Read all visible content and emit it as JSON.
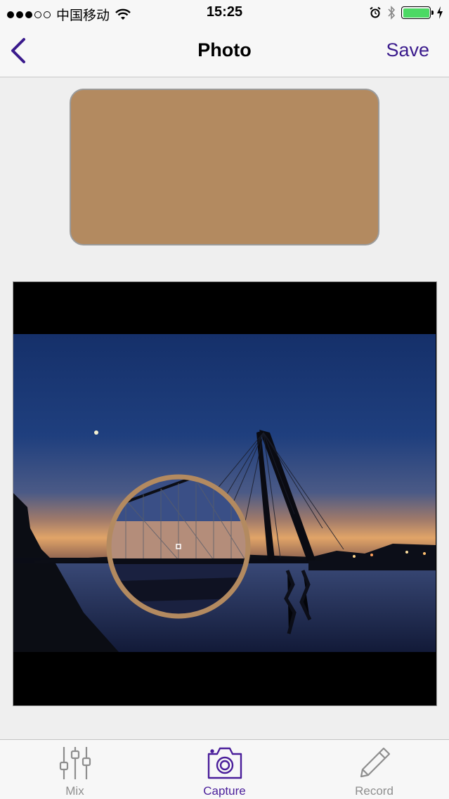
{
  "status_bar": {
    "carrier": "中国移动",
    "time": "15:25",
    "battery_level": 1.0
  },
  "nav": {
    "title": "Photo",
    "save_label": "Save",
    "back_icon": "chevron-left-icon"
  },
  "swatch": {
    "color": "#b38a60"
  },
  "photo": {
    "loupe_ring_color": "#b38a60"
  },
  "tabs": [
    {
      "label": "Mix",
      "icon": "sliders-icon",
      "active": false
    },
    {
      "label": "Capture",
      "icon": "camera-icon",
      "active": true
    },
    {
      "label": "Record",
      "icon": "pencil-icon",
      "active": false
    }
  ],
  "colors": {
    "accent": "#3a1a8c",
    "tab_active": "#4a1e9a",
    "tab_inactive": "#8e8e8e"
  }
}
